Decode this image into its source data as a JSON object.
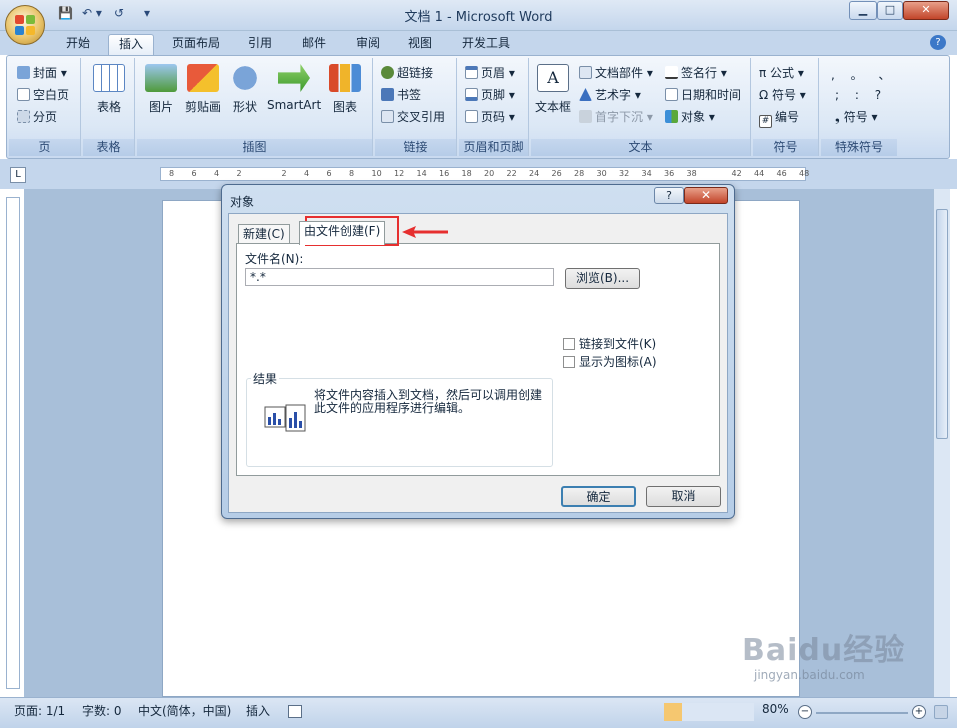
{
  "window": {
    "title": "文档 1 - Microsoft Word",
    "min": "▁",
    "max": "□",
    "close": "✕"
  },
  "qat": {
    "save": "💾",
    "undo": "↶ ▾",
    "redo": "↺",
    "customize": "▾"
  },
  "tabs": [
    "开始",
    "插入",
    "页面布局",
    "引用",
    "邮件",
    "审阅",
    "视图",
    "开发工具"
  ],
  "ribbon": {
    "pages": {
      "label": "页",
      "cover": "封面 ▾",
      "blank": "空白页",
      "break": "分页"
    },
    "tables": {
      "label": "表格",
      "table": "表格"
    },
    "illustrations": {
      "label": "插图",
      "picture": "图片",
      "clipart": "剪贴画",
      "shapes": "形状",
      "smartart": "SmartArt",
      "chart": "图表"
    },
    "links": {
      "label": "链接",
      "hyperlink": "超链接",
      "bookmark": "书签",
      "crossref": "交叉引用"
    },
    "headerfooter": {
      "label": "页眉和页脚",
      "header": "页眉 ▾",
      "footer": "页脚 ▾",
      "pagenum": "页码 ▾"
    },
    "text": {
      "label": "文本",
      "textbox": "文本框",
      "quickparts": "文档部件 ▾",
      "wordart": "艺术字 ▾",
      "dropcap": "首字下沉 ▾",
      "signature": "签名行 ▾",
      "datetime": "日期和时间",
      "object": "对象 ▾"
    },
    "symbols": {
      "label": "符号",
      "equation": "π 公式 ▾",
      "symbol": "Ω 符号 ▾",
      "numbering": "编号"
    },
    "special": {
      "label": "特殊符号",
      "row1": ",  。 、",
      "row2": ";  :  ?",
      "symbol": "符号 ▾"
    }
  },
  "ruler_ticks": [
    "8",
    "6",
    "4",
    "2",
    "",
    "2",
    "4",
    "6",
    "8",
    "10",
    "12",
    "14",
    "16",
    "18",
    "20",
    "22",
    "24",
    "26",
    "28",
    "30",
    "32",
    "34",
    "36",
    "38",
    "",
    "42",
    "44",
    "46",
    "48"
  ],
  "dialog": {
    "title": "对象",
    "help": "?",
    "close": "✕",
    "tab_new": "新建(C)",
    "tab_fromfile": "由文件创建(F)",
    "filename_label": "文件名(N):",
    "filename_value": "*.*",
    "browse": "浏览(B)...",
    "link_to_file": "链接到文件(K)",
    "display_as_icon": "显示为图标(A)",
    "result_label": "结果",
    "result_text": "将文件内容插入到文档，然后可以调用创建此文件的应用程序进行编辑。",
    "ok": "确定",
    "cancel": "取消"
  },
  "status": {
    "page": "页面: 1/1",
    "words": "字数: 0",
    "lang": "中文(简体，中国)",
    "mode": "插入",
    "zoom": "80%"
  },
  "watermark": {
    "brand": "Baidu经验",
    "url": "jingyan.baidu.com"
  },
  "colors": {
    "accent": "#e62f2f",
    "ribbon": "#dbe7f5",
    "titlebar": "#c4d6ec"
  }
}
